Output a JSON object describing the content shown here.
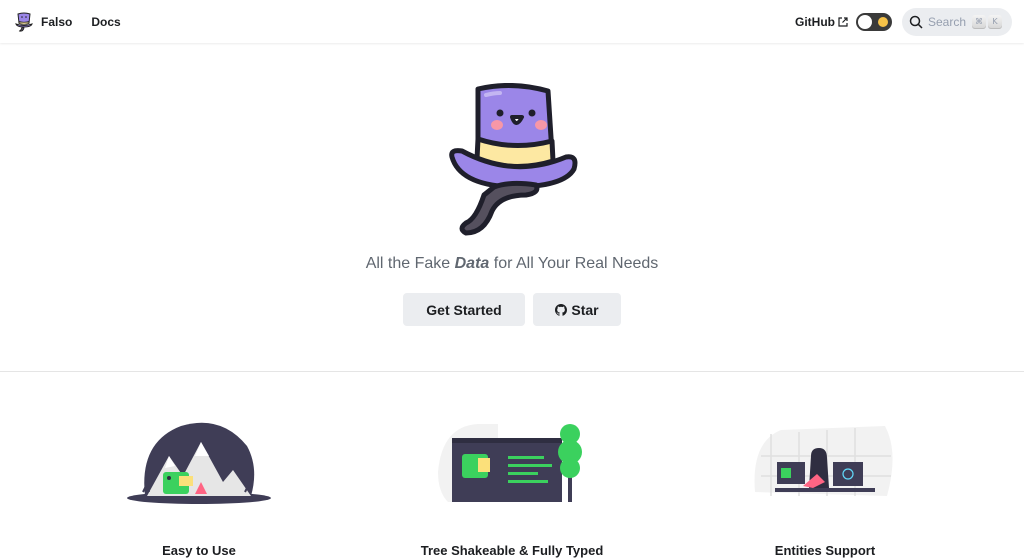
{
  "navbar": {
    "brand": "Falso",
    "links": [
      "Docs"
    ],
    "github_label": "GitHub",
    "search_placeholder": "Search",
    "search_keys": [
      "⌘",
      "K"
    ]
  },
  "hero": {
    "tagline_prefix": "All the Fake ",
    "tagline_emphasis": "Data",
    "tagline_suffix": " for All Your Real Needs",
    "primary_button": "Get Started",
    "star_button": "Star"
  },
  "features": [
    {
      "title": "Easy to Use"
    },
    {
      "title": "Tree Shakeable & Fully Typed"
    },
    {
      "title": "Entities Support"
    }
  ],
  "colors": {
    "mascot_purple": "#9b86e8",
    "mascot_band": "#fde8a2",
    "illustration_green": "#3bd15e",
    "illustration_dark": "#3f3d56",
    "illustration_pink": "#ff6584"
  }
}
